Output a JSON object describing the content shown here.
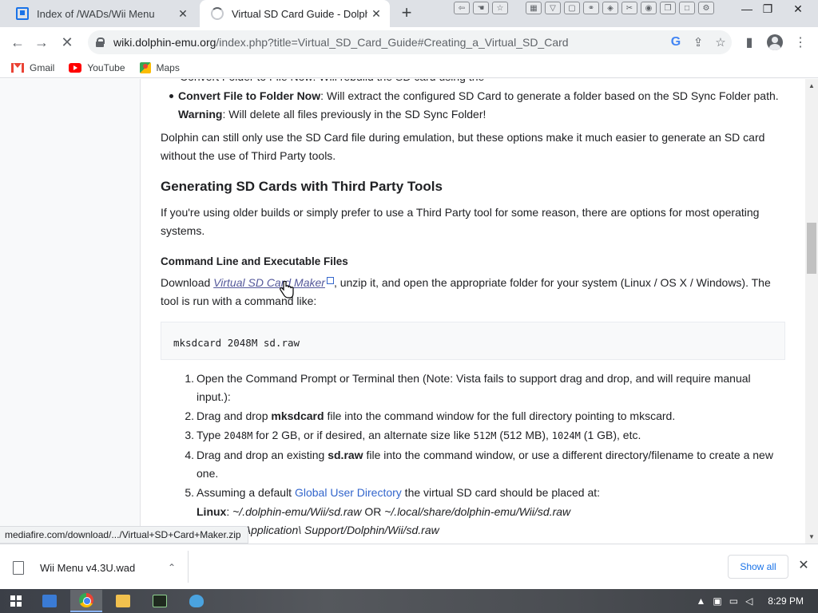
{
  "browser": {
    "tabs": [
      {
        "title": "Index of /WADs/Wii Menu",
        "close": "✕"
      },
      {
        "title": "Virtual SD Card Guide - Dolphin Emulator Wiki",
        "close": "✕"
      }
    ],
    "new_tab_label": "+",
    "window_controls": {
      "minimize": "—",
      "restore": "❐",
      "close": "✕"
    },
    "nav": {
      "back": "←",
      "forward": "→",
      "stop": "✕"
    },
    "url_host": "wiki.dolphin-emu.org",
    "url_path": "/index.php?title=Virtual_SD_Card_Guide#Creating_a_Virtual_SD_Card",
    "omnibox_icons": {
      "google": "G",
      "share": "⇪",
      "bookmark": "☆"
    },
    "toolbar_icons": {
      "side_panel": "▮",
      "menu": "⋮"
    },
    "bookmarks": [
      {
        "label": "Gmail",
        "icon": "gmail-icon"
      },
      {
        "label": "YouTube",
        "icon": "youtube-icon"
      },
      {
        "label": "Maps",
        "icon": "maps-icon"
      }
    ]
  },
  "article": {
    "cut_line_text": "Convert Folder to File Now: Will rebuild the SD card using the",
    "bullet_bold": "Convert File to Folder Now",
    "bullet_text": ": Will extract the configured SD Card to generate a folder based on the SD Sync Folder path.",
    "warning_bold": "Warning",
    "warning_text": ": Will delete all files previously in the SD Sync Folder!",
    "para1": "Dolphin can still only use the SD Card file during emulation, but these options make it much easier to generate an SD card without the use of Third Party tools.",
    "heading": "Generating SD Cards with Third Party Tools",
    "para2": "If you're using older builds or simply prefer to use a Third Party tool for some reason, there are options for most operating systems.",
    "subheading": "Command Line and Executable Files",
    "download_prefix": "Download ",
    "download_link": "Virtual SD Card Maker",
    "download_suffix": ", unzip it, and open the appropriate folder for your system (Linux / OS X / Windows). The tool is run with a command like:",
    "code": "mksdcard 2048M sd.raw",
    "steps": [
      {
        "num": "1.",
        "text": "Open the Command Prompt or Terminal then (Note: Vista fails to support drag and drop, and will require manual input.):"
      },
      {
        "num": "2.",
        "pre": "Drag and drop ",
        "bold": "mksdcard",
        "post": " file into the command window for the full directory pointing to mkscard."
      },
      {
        "num": "3.",
        "pre": "Type ",
        "code1": "2048M",
        "mid1": " for 2 GB, or if desired, an alternate size like ",
        "code2": "512M",
        "mid2": " (512 MB), ",
        "code3": "1024M",
        "post": " (1 GB), etc."
      },
      {
        "num": "4.",
        "pre": "Drag and drop an existing ",
        "bold": "sd.raw",
        "post": " file into the command window, or use a different directory/filename to create a new one."
      },
      {
        "num": "5.",
        "pre": "Assuming a default ",
        "link": "Global User Directory",
        "post": " the virtual SD card should be placed at:"
      }
    ],
    "linux_label": "Linux",
    "linux_path1": "~/.dolphin-emu/Wii/sd.raw",
    "linux_or": " OR ",
    "linux_path2": "~/.local/share/dolphin-emu/Wii/sd.raw",
    "mac_path": "~/Library/Application\\ Support/Dolphin/Wii/sd.raw"
  },
  "status_url": "mediafire.com/download/.../Virtual+SD+Card+Maker.zip",
  "downloads": {
    "file_name": "Wii Menu v4.3U.wad",
    "chevron": "⌃",
    "show_all": "Show all",
    "close": "✕"
  },
  "taskbar": {
    "clock": "8:29 PM",
    "tray_up": "▲"
  },
  "colors": {
    "link": "#3366cc",
    "visited_link": "#54589a",
    "accent": "#1a73e8"
  }
}
